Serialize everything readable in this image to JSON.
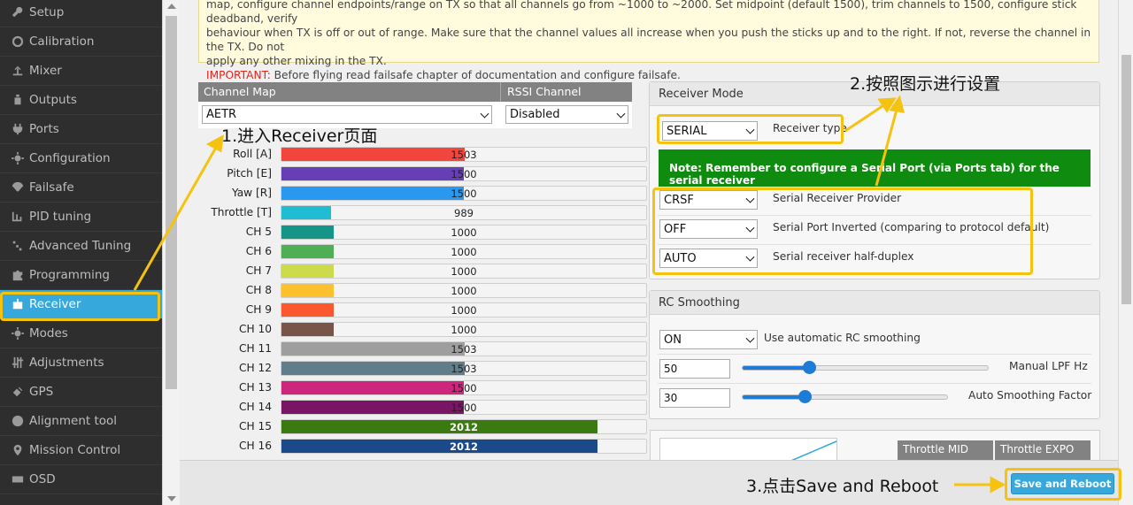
{
  "sidebar": {
    "items": [
      {
        "label": "Setup",
        "icon": "wrench-icon"
      },
      {
        "label": "Calibration",
        "icon": "crosshair-icon"
      },
      {
        "label": "Mixer",
        "icon": "mixer-icon"
      },
      {
        "label": "Outputs",
        "icon": "motor-icon"
      },
      {
        "label": "Ports",
        "icon": "plug-icon"
      },
      {
        "label": "Configuration",
        "icon": "gear-icon"
      },
      {
        "label": "Failsafe",
        "icon": "parachute-icon"
      },
      {
        "label": "PID tuning",
        "icon": "pid-icon"
      },
      {
        "label": "Advanced Tuning",
        "icon": "advanced-tuning-icon"
      },
      {
        "label": "Programming",
        "icon": "puzzle-icon"
      },
      {
        "label": "Receiver",
        "icon": "receiver-icon",
        "active": true
      },
      {
        "label": "Modes",
        "icon": "modes-gear-icon"
      },
      {
        "label": "Adjustments",
        "icon": "sliders-icon"
      },
      {
        "label": "GPS",
        "icon": "satellite-icon"
      },
      {
        "label": "Alignment tool",
        "icon": "alignment-icon"
      },
      {
        "label": "Mission Control",
        "icon": "map-pin-icon"
      },
      {
        "label": "OSD",
        "icon": "osd-icon"
      }
    ]
  },
  "notice": {
    "line1": "map, configure channel endpoints/range on TX so that all channels go from ~1000 to ~2000. Set midpoint (default 1500), trim channels to 1500, configure stick deadband, verify",
    "line2": "behaviour when TX is off or out of range. Make sure that the channel values all increase when you push the sticks up and to the right. If not, reverse the channel in the TX. Do not",
    "line3": "apply any other mixing in the TX.",
    "important_label": "IMPORTANT:",
    "important_text": " Before flying read failsafe chapter of documentation and configure failsafe."
  },
  "channel_map": {
    "header_map": "Channel Map",
    "header_rssi": "RSSI Channel",
    "map_value": "AETR",
    "rssi_value": "Disabled"
  },
  "channels": [
    {
      "label": "Roll [A]",
      "value": 1503,
      "color": "#f1453d"
    },
    {
      "label": "Pitch [E]",
      "value": 1500,
      "color": "#673fb4"
    },
    {
      "label": "Yaw [R]",
      "value": 1500,
      "color": "#2b98f0"
    },
    {
      "label": "Throttle [T]",
      "value": 989,
      "color": "#1fbcd2"
    },
    {
      "label": "CH 5",
      "value": 1000,
      "color": "#159588"
    },
    {
      "label": "CH 6",
      "value": 1000,
      "color": "#50ae55"
    },
    {
      "label": "CH 7",
      "value": 1000,
      "color": "#cdda49"
    },
    {
      "label": "CH 8",
      "value": 1000,
      "color": "#fdc02f"
    },
    {
      "label": "CH 9",
      "value": 1000,
      "color": "#fc5830"
    },
    {
      "label": "CH 10",
      "value": 1000,
      "color": "#785549"
    },
    {
      "label": "CH 11",
      "value": 1503,
      "color": "#9e9e9e"
    },
    {
      "label": "CH 12",
      "value": 1503,
      "color": "#617d8a"
    },
    {
      "label": "CH 13",
      "value": 1500,
      "color": "#cf267d"
    },
    {
      "label": "CH 14",
      "value": 1500,
      "color": "#7a1464"
    },
    {
      "label": "CH 15",
      "value": 2012,
      "color": "#3a7a10"
    },
    {
      "label": "CH 16",
      "value": 2012,
      "color": "#1b4a8a"
    }
  ],
  "receiver_mode": {
    "title": "Receiver Mode",
    "type_value": "SERIAL",
    "type_label": "Receiver type",
    "note": "Note: Remember to configure a Serial Port (via Ports tab) for the serial receiver",
    "provider_value": "CRSF",
    "provider_label": "Serial Receiver Provider",
    "inverted_value": "OFF",
    "inverted_label": "Serial Port Inverted (comparing to protocol default)",
    "halfduplex_value": "AUTO",
    "halfduplex_label": "Serial receiver half-duplex"
  },
  "rc_smoothing": {
    "title": "RC Smoothing",
    "auto_value": "ON",
    "auto_label": "Use automatic RC smoothing",
    "lpf_value": "50",
    "lpf_label": "Manual LPF Hz",
    "lpf_level": 0.27,
    "factor_value": "30",
    "factor_label": "Auto Smoothing Factor",
    "factor_level": 0.3
  },
  "throttle": {
    "mid_label": "Throttle MID",
    "expo_label": "Throttle EXPO"
  },
  "toolbar": {
    "save_label": "Save and Reboot"
  },
  "annotations": {
    "step1": "1.进入Receiver页面",
    "step2": "2.按照图示进行设置",
    "step3": "3.点击Save and Reboot"
  },
  "colors": {
    "accent": "#37a8db",
    "highlight": "#f5c210",
    "note_green": "#0f8b0f"
  }
}
